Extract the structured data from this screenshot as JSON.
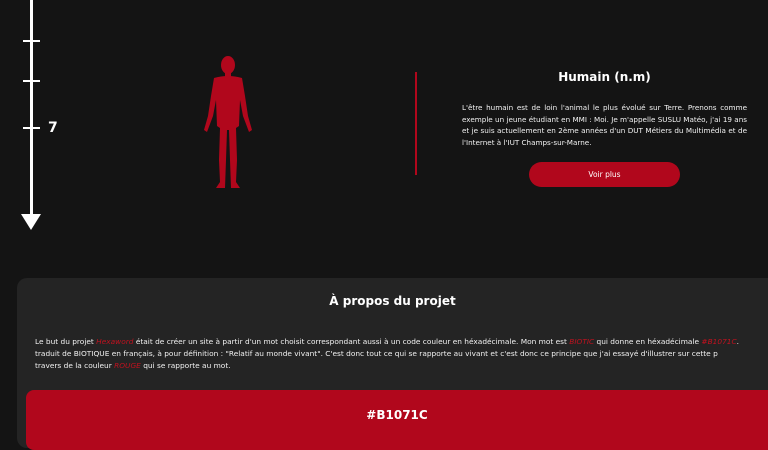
{
  "timeline": {
    "label": "7"
  },
  "info": {
    "title": "Humain (n.m)",
    "text": "L'être humain est de loin l'animal le plus évolué sur Terre. Prenons comme exemple un jeune étudiant en MMI : Moi. Je m'appelle SUSLU Matéo, j'ai 19 ans et je suis actuellement en 2ème années d'un DUT Métiers du Multimédia et de l'Internet à l'IUT Champs-sur-Marne.",
    "button_label": "Voir plus"
  },
  "about": {
    "title": "À propos du projet",
    "line1_a": "Le but du projet ",
    "line1_hl1": "Hexaword",
    "line1_b": " était de créer un site à partir d'un mot choisit correspondant aussi à un code couleur en héxadécimale. Mon mot est ",
    "line1_hl2": "BIOTIC",
    "line1_c": " qui donne en héxadécimale ",
    "line1_hl3": "#B1071C",
    "line1_d": ".",
    "line2": "traduit de BIOTIQUE en français, à pour définition : \"Relatif au monde vivant\". C'est donc tout ce qui se rapporte au vivant et c'est donc ce principe que j'ai essayé d'illustrer sur cette p",
    "line3_a": "travers de la couleur ",
    "line3_hl": "ROUGE",
    "line3_b": " qui se rapporte au mot.",
    "color_code": "#B1071C"
  },
  "colors": {
    "accent": "#b1071c",
    "background": "#141414",
    "panel": "#242424"
  }
}
